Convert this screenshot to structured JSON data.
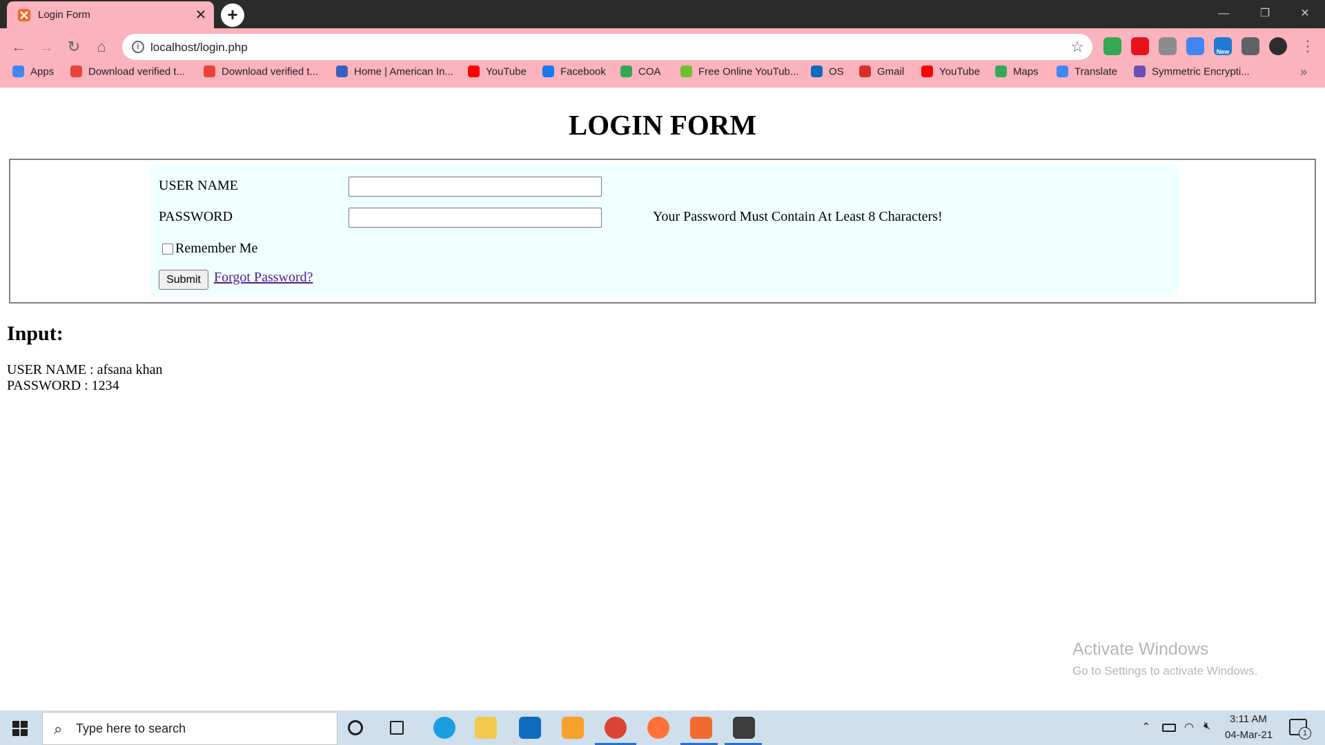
{
  "browser": {
    "tab_title": "Login Form",
    "tab_close": "✕",
    "new_tab": "+",
    "url": "localhost/login.php",
    "window_controls": [
      "—",
      "❐",
      "✕"
    ],
    "extensions": [
      {
        "icon": "google-drive-icon",
        "color": "#34a853"
      },
      {
        "icon": "adblock-icon",
        "color": "#e8121b"
      },
      {
        "icon": "square-extension-icon",
        "color": "#8c8c8c"
      },
      {
        "icon": "google-translate-icon",
        "color": "#4285f4"
      },
      {
        "icon": "new-badge-icon",
        "color": "#1e7ad3",
        "label": "New"
      },
      {
        "icon": "puzzle-extensions-icon",
        "color": "#5f6368"
      },
      {
        "icon": "profile-avatar-icon",
        "color": "#2d2d2d"
      }
    ]
  },
  "bookmarks": [
    {
      "label": "Apps",
      "icon": "apps-grid-icon",
      "color": "#4285f4"
    },
    {
      "label": "Download verified t...",
      "icon": "x-icon",
      "color": "#ea4335"
    },
    {
      "label": "Download verified t...",
      "icon": "x-icon",
      "color": "#ea4335"
    },
    {
      "label": "Home | American In...",
      "icon": "globe-icon",
      "color": "#3b5fbf"
    },
    {
      "label": "YouTube",
      "icon": "youtube-icon",
      "color": "#ff0000"
    },
    {
      "label": "Facebook",
      "icon": "facebook-icon",
      "color": "#1877f2"
    },
    {
      "label": "COA",
      "icon": "google-drive-icon",
      "color": "#34a853"
    },
    {
      "label": "Free Online YouTub...",
      "icon": "download-arrow-icon",
      "color": "#6fbf2f"
    },
    {
      "label": "OS",
      "icon": "onedrive-icon",
      "color": "#0f6cbd"
    },
    {
      "label": "Gmail",
      "icon": "gmail-icon",
      "color": "#d93025"
    },
    {
      "label": "YouTube",
      "icon": "youtube-icon",
      "color": "#ff0000"
    },
    {
      "label": "Maps",
      "icon": "maps-icon",
      "color": "#34a853"
    },
    {
      "label": "Translate",
      "icon": "google-translate-icon",
      "color": "#4285f4"
    },
    {
      "label": "Symmetric Encrypti...",
      "icon": "lock-key-icon",
      "color": "#6b4fb8"
    }
  ],
  "page": {
    "title": "LOGIN FORM",
    "username_label": "USER NAME",
    "password_label": "PASSWORD",
    "username_value": "",
    "password_value": "",
    "password_hint": "Your Password Must Contain At Least 8 Characters!",
    "remember_label": "Remember Me",
    "remember_checked": false,
    "submit_label": "Submit",
    "forgot_label": "Forgot Password?",
    "input_heading": "Input:",
    "output_username": "USER NAME : afsana khan",
    "output_password": "PASSWORD : 1234"
  },
  "watermark": {
    "title": "Activate Windows",
    "subtitle": "Go to Settings to activate Windows."
  },
  "taskbar": {
    "search_placeholder": "Type here to search",
    "apps": [
      {
        "icon": "cortana-icon",
        "color": "#1f1f1f"
      },
      {
        "icon": "task-view-icon",
        "color": "#1f1f1f"
      },
      {
        "icon": "edge-icon",
        "color": "#1b9de2"
      },
      {
        "icon": "file-explorer-icon",
        "color": "#f2c94c"
      },
      {
        "icon": "mail-icon",
        "color": "#0f6cbd"
      },
      {
        "icon": "photos-icon",
        "color": "#f7a12b"
      },
      {
        "icon": "chrome-icon",
        "color": "#db4437"
      },
      {
        "icon": "firefox-icon",
        "color": "#ff7139"
      },
      {
        "icon": "xampp-icon",
        "color": "#f26a2e"
      },
      {
        "icon": "sublime-text-icon",
        "color": "#3c3c3c"
      }
    ],
    "time": "3:11 AM",
    "date": "04-Mar-21",
    "notification_count": "1"
  }
}
